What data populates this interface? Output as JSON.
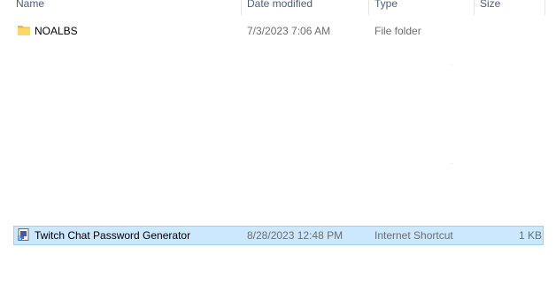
{
  "columns": {
    "name": "Name",
    "date_modified": "Date modified",
    "type": "Type",
    "size": "Size"
  },
  "files": [
    {
      "name": "NOALBS",
      "date_modified": "7/3/2023 7:06 AM",
      "type": "File folder",
      "size": "",
      "icon": "folder-icon",
      "selected": false
    },
    {
      "name": "Twitch Chat Password Generator",
      "date_modified": "8/28/2023 12:48 PM",
      "type": "Internet Shortcut",
      "size": "1 KB",
      "icon": "internet-shortcut-icon",
      "selected": true
    }
  ],
  "colors": {
    "header_text": "#4c607a",
    "selection_fill": "#cce8ff",
    "selection_border": "#99d1ff",
    "folder_yellow": "#ffd761"
  }
}
